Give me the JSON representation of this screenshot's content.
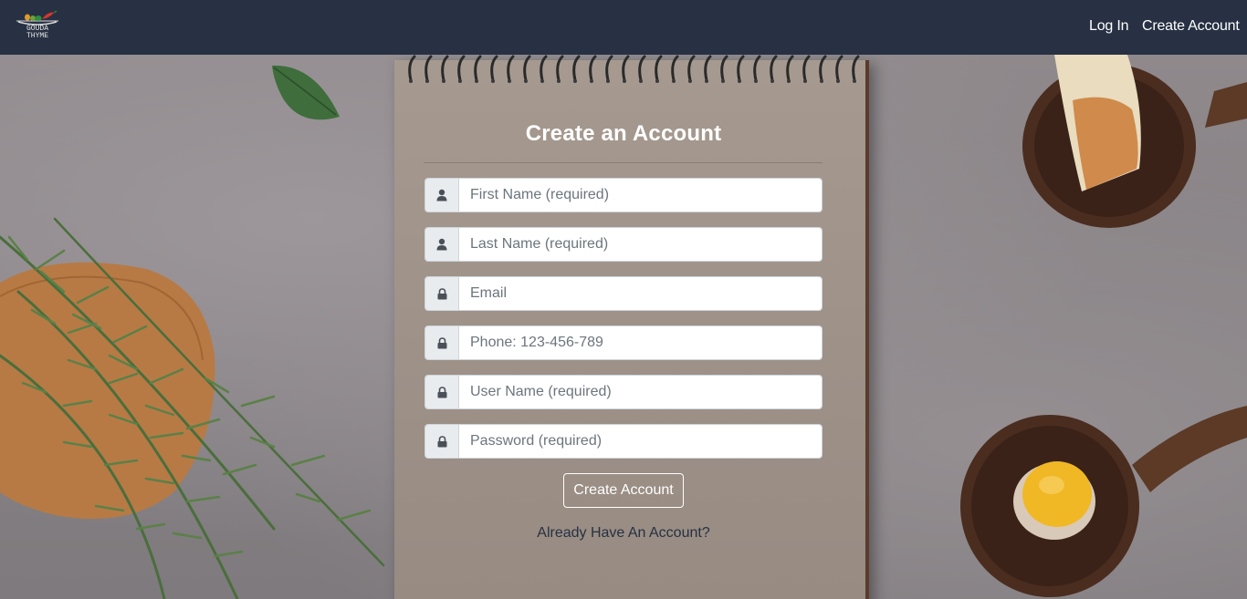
{
  "brand": {
    "logo_text_top": "GOUDA",
    "logo_text_bottom": "THYME"
  },
  "nav": {
    "login_label": "Log In",
    "create_label": "Create Account"
  },
  "form": {
    "title": "Create an Account",
    "fields": [
      {
        "placeholder": "First Name (required)",
        "icon": "user-icon"
      },
      {
        "placeholder": "Last Name (required)",
        "icon": "user-icon"
      },
      {
        "placeholder": "Email",
        "icon": "lock-icon"
      },
      {
        "placeholder": "Phone: 123-456-789",
        "icon": "lock-icon"
      },
      {
        "placeholder": "User Name (required)",
        "icon": "lock-icon"
      },
      {
        "placeholder": "Password (required)",
        "icon": "lock-icon"
      }
    ],
    "submit_label": "Create Account",
    "already_label": "Already Have An Account?"
  },
  "colors": {
    "navbar": "#273143",
    "notebook": "#a69a90",
    "addon": "#e9ecef",
    "link": "#273143"
  }
}
